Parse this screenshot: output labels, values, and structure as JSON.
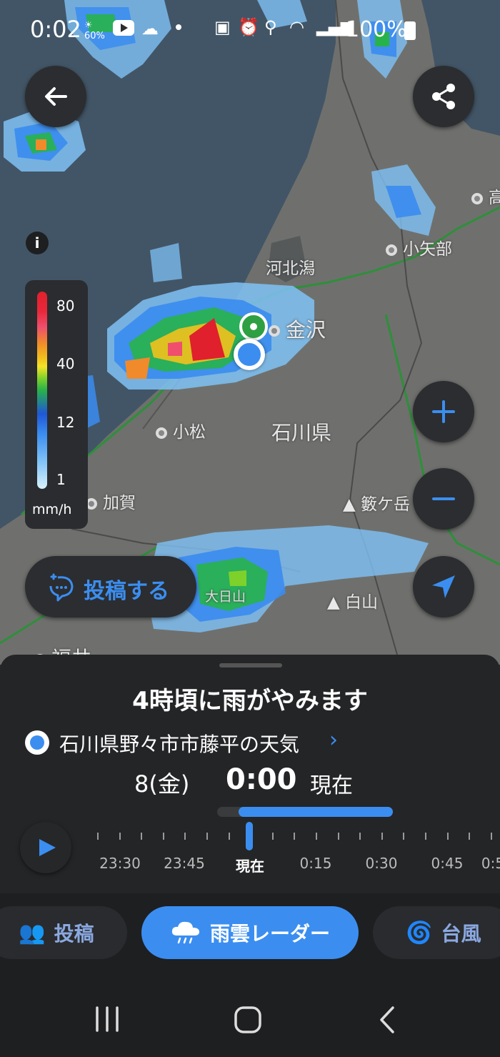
{
  "status_bar": {
    "time": "0:02",
    "weather_small": "60%",
    "battery": "100%"
  },
  "map": {
    "labels": {
      "kahokugata": "河北潟",
      "kanazawa": "金沢",
      "komatsu": "小松",
      "ishikawa": "石川県",
      "kaga": "加賀",
      "oyabe": "小矢部",
      "takaoka": "高",
      "hakusan_mtn": "白山",
      "tsurugigatake": "籔ケ岳",
      "ohinichiyama": "大日山",
      "fukui": "福井"
    }
  },
  "legend": {
    "values": [
      "80",
      "40",
      "12",
      "1"
    ],
    "unit": "mm/h"
  },
  "post_button": {
    "label": "投稿する"
  },
  "sheet": {
    "headline": "4時頃に雨がやみます",
    "location": "石川県野々市市藤平の天気",
    "date": "8(金)",
    "time": "0:00",
    "now": "現在",
    "timeline": [
      "23:30",
      "23:45",
      "現在",
      "0:15",
      "0:30",
      "0:45",
      "0:5"
    ]
  },
  "bottom_nav": {
    "post": "投稿",
    "radar": "雨雲レーダー",
    "typhoon": "台風"
  },
  "colors": {
    "accent": "#3b8ef0",
    "sheet_bg": "#242527"
  }
}
